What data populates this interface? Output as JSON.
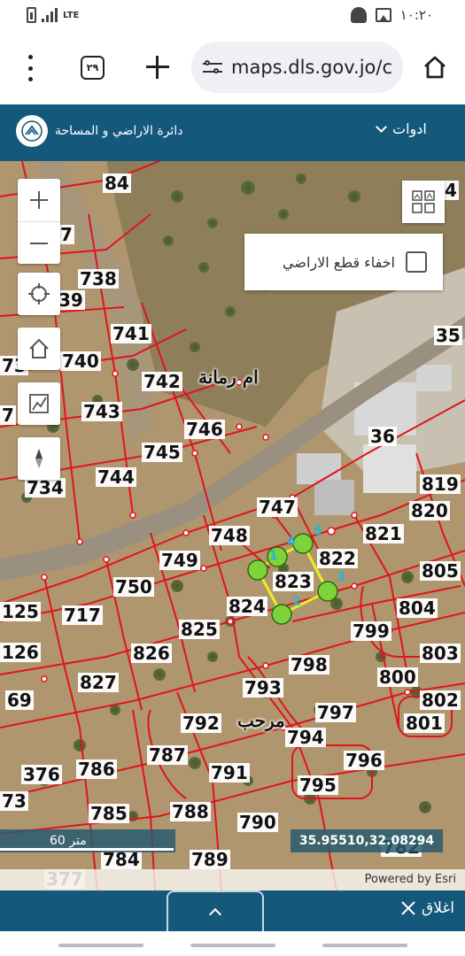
{
  "status_bar": {
    "network": "LTE",
    "time": "١٠:٢٠"
  },
  "browser": {
    "tab_count": "٢٩",
    "url": "maps.dls.gov.jo/c"
  },
  "app": {
    "title": "دائرة الاراضي و المساحة",
    "tools_label": "ادوات"
  },
  "map": {
    "hide_parcels_label": "اخفاء قطع الاراضي",
    "hide_parcels_checked": false,
    "area_names": [
      "ام رمانة",
      "مرحب"
    ],
    "parcels": [
      "84",
      "4",
      "7",
      "738",
      "39",
      "741",
      "35",
      "740",
      "742",
      "73",
      "7",
      "743",
      "746",
      "36",
      "745",
      "734",
      "744",
      "819",
      "747",
      "820",
      "748",
      "821",
      "749",
      "822",
      "805",
      "823",
      "750",
      "824",
      "804",
      "125",
      "717",
      "825",
      "799",
      "126",
      "826",
      "803",
      "798",
      "800",
      "69",
      "827",
      "802",
      "793",
      "797",
      "792",
      "801",
      "794",
      "787",
      "796",
      "376",
      "786",
      "791",
      "795",
      "73",
      "785",
      "788",
      "790",
      "782",
      "784",
      "789",
      "377"
    ],
    "vertex_labels": [
      "1",
      "2",
      "3",
      "4",
      "5"
    ],
    "scale_label": "60 متر",
    "coordinates": "35.95510,32.08294",
    "attribution": "Powered by Esri"
  },
  "bottom_panel": {
    "close_label": "اغلاق"
  },
  "icons": {
    "zoom_in": "plus-icon",
    "zoom_out": "minus-icon",
    "locate": "crosshair-icon",
    "home": "home-icon",
    "measure": "measure-icon",
    "compass": "compass-icon",
    "basemap": "grid-icon"
  },
  "colors": {
    "header_bg": "#14587b",
    "parcel_lines": "#e0141c",
    "selection": "#e8f020",
    "vertex": "#7ed23a"
  }
}
